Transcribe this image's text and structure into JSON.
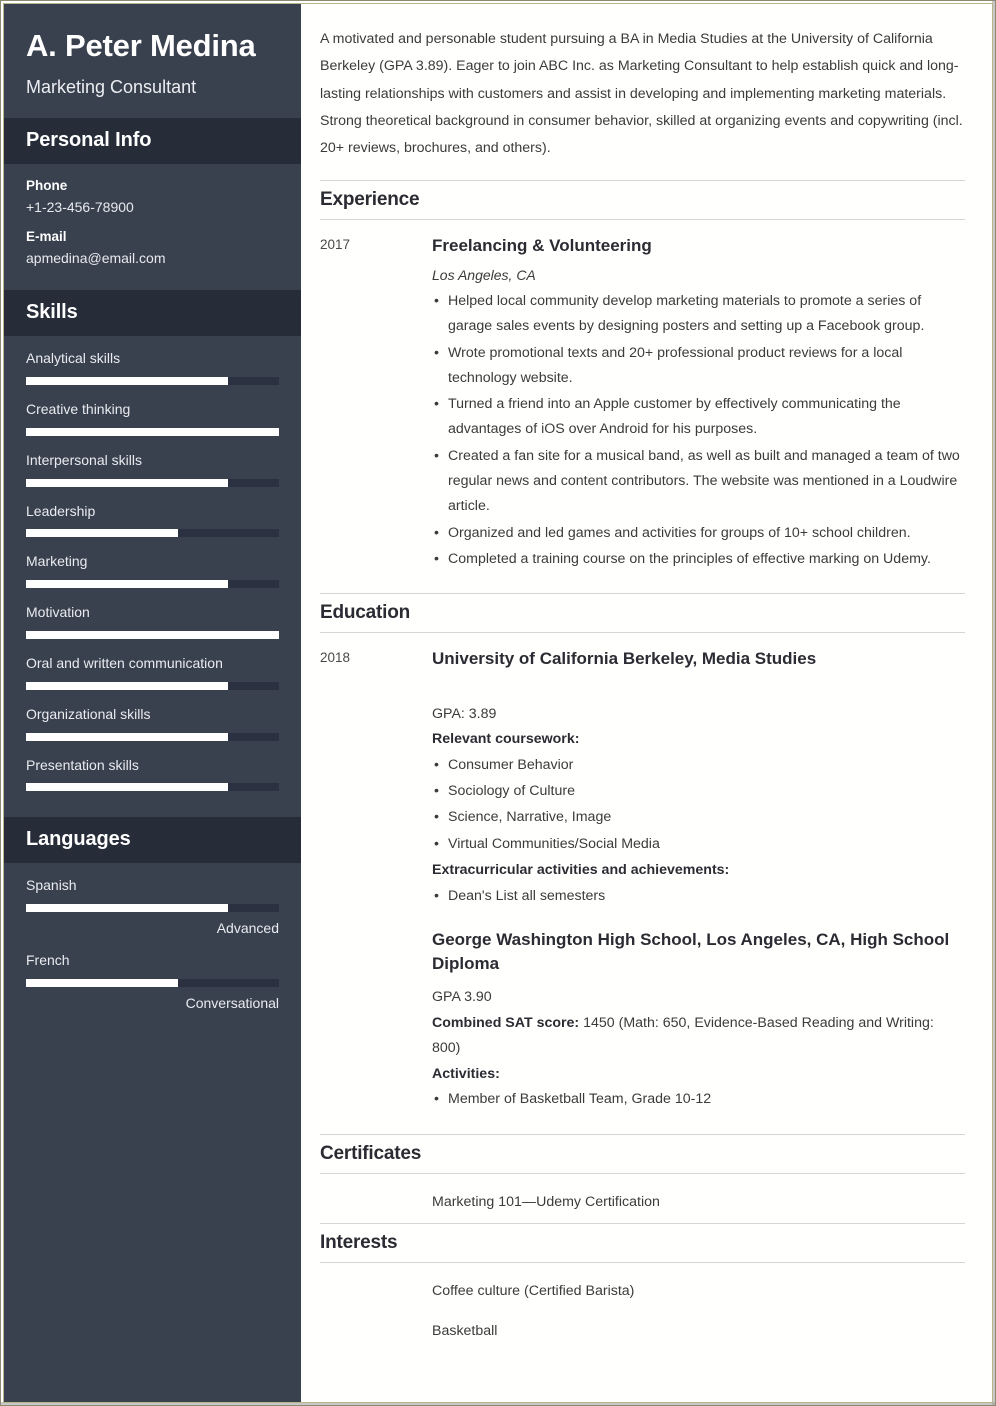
{
  "sidebar": {
    "name": "A. Peter Medina",
    "job_title": "Marketing Consultant",
    "personal_info": {
      "heading": "Personal Info",
      "fields": [
        {
          "label": "Phone",
          "value": "+1-23-456-78900"
        },
        {
          "label": "E-mail",
          "value": "apmedina@email.com"
        }
      ]
    },
    "skills": {
      "heading": "Skills",
      "items": [
        {
          "label": "Analytical skills",
          "percent": 80
        },
        {
          "label": "Creative thinking",
          "percent": 100
        },
        {
          "label": "Interpersonal skills",
          "percent": 80
        },
        {
          "label": "Leadership",
          "percent": 60
        },
        {
          "label": "Marketing",
          "percent": 80
        },
        {
          "label": "Motivation",
          "percent": 100
        },
        {
          "label": "Oral and written communication",
          "percent": 80
        },
        {
          "label": "Organizational skills",
          "percent": 80
        },
        {
          "label": "Presentation skills",
          "percent": 80
        }
      ]
    },
    "languages": {
      "heading": "Languages",
      "items": [
        {
          "label": "Spanish",
          "percent": 80,
          "level": "Advanced"
        },
        {
          "label": "French",
          "percent": 60,
          "level": "Conversational"
        }
      ]
    }
  },
  "main": {
    "summary": "A motivated and personable student pursuing a BA in Media Studies at the University of California Berkeley (GPA 3.89). Eager to join ABC Inc. as Marketing Consultant to help establish quick and long-lasting relationships with customers and assist in developing and implementing marketing materials. Strong theoretical background in consumer behavior, skilled at organizing events and copywriting (incl. 20+ reviews, brochures, and others).",
    "experience": {
      "heading": "Experience",
      "date": "2017",
      "title": "Freelancing & Volunteering",
      "location": "Los Angeles, CA",
      "bullets": [
        "Helped local community develop marketing materials to promote a series of garage sales events by designing posters and setting up a Facebook group.",
        "Wrote promotional texts and 20+ professional product reviews for a local technology website.",
        "Turned a friend into an Apple customer by effectively communicating the advantages of iOS over Android for his purposes.",
        "Created a fan site for a musical band, as well as built and managed a team of two regular news and content contributors. The website was mentioned in a Loudwire article.",
        "Organized and led games and activities for groups of 10+ school children.",
        "Completed a training course on the principles of effective marking on Udemy."
      ]
    },
    "education": {
      "heading": "Education",
      "date": "2018",
      "university": {
        "title": "University of California Berkeley, Media Studies",
        "gpa": "GPA: 3.89",
        "coursework_heading": "Relevant coursework:",
        "coursework": [
          "Consumer Behavior",
          "Sociology of Culture",
          "Science, Narrative, Image",
          "Virtual Communities/Social Media"
        ],
        "extracurricular_heading": "Extracurricular activities and achievements:",
        "extracurricular": [
          "Dean's List all semesters"
        ]
      },
      "highschool": {
        "title": "George Washington High School, Los Angeles, CA, High School Diploma",
        "gpa": "GPA 3.90",
        "sat_label": "Combined SAT score:",
        "sat_value": "1450 (Math: 650, Evidence-Based Reading and Writing: 800)",
        "activities_heading": "Activities:",
        "activities": [
          "Member of Basketball Team, Grade 10-12"
        ]
      }
    },
    "certificates": {
      "heading": "Certificates",
      "items": [
        "Marketing 101—Udemy Certification"
      ]
    },
    "interests": {
      "heading": "Interests",
      "items": [
        "Coffee culture (Certified Barista)",
        "Basketball"
      ]
    }
  }
}
